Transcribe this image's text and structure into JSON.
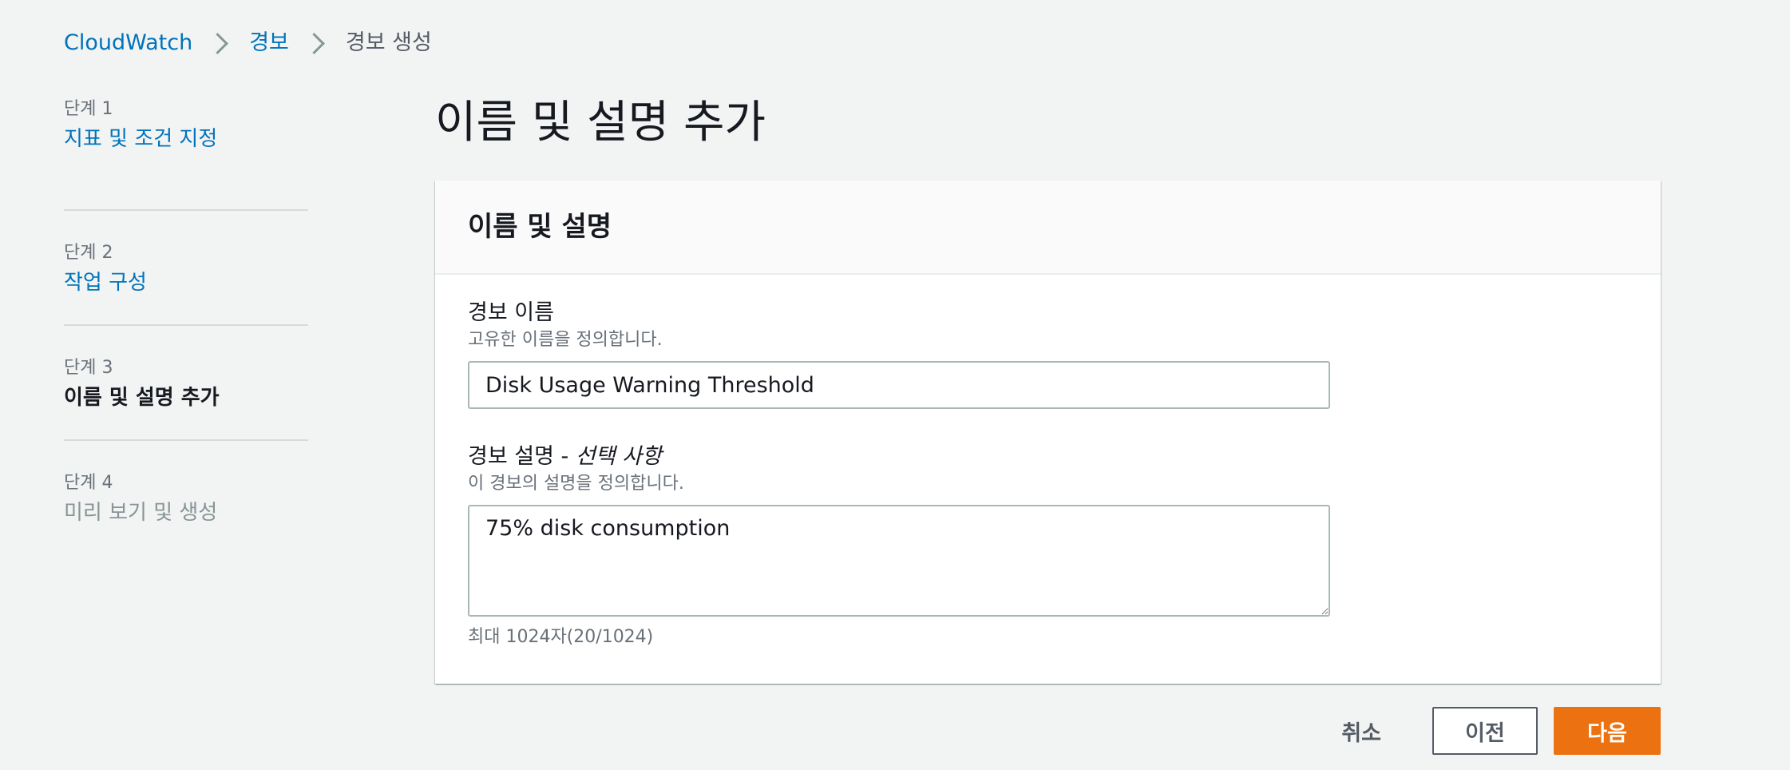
{
  "breadcrumb": {
    "items": [
      "CloudWatch",
      "경보",
      "경보 생성"
    ]
  },
  "steps": [
    {
      "num": "단계 1",
      "title": "지표 및 조건 지정",
      "state": "link"
    },
    {
      "num": "단계 2",
      "title": "작업 구성",
      "state": "link"
    },
    {
      "num": "단계 3",
      "title": "이름 및 설명 추가",
      "state": "active"
    },
    {
      "num": "단계 4",
      "title": "미리 보기 및 생성",
      "state": "disabled"
    }
  ],
  "page": {
    "title": "이름 및 설명 추가"
  },
  "panel": {
    "title": "이름 및 설명",
    "name_field": {
      "label": "경보 이름",
      "description": "고유한 이름을 정의합니다.",
      "value": "Disk Usage Warning Threshold"
    },
    "desc_field": {
      "label": "경보 설명 - ",
      "optional": "선택 사항",
      "description": "이 경보의 설명을 정의합니다.",
      "value": "75% disk consumption",
      "char_count": "최대 1024자(20/1024)"
    }
  },
  "footer": {
    "cancel": "취소",
    "previous": "이전",
    "next": "다음"
  },
  "colors": {
    "link": "#0073bb",
    "primary": "#ec7211",
    "background": "#f2f3f3"
  }
}
